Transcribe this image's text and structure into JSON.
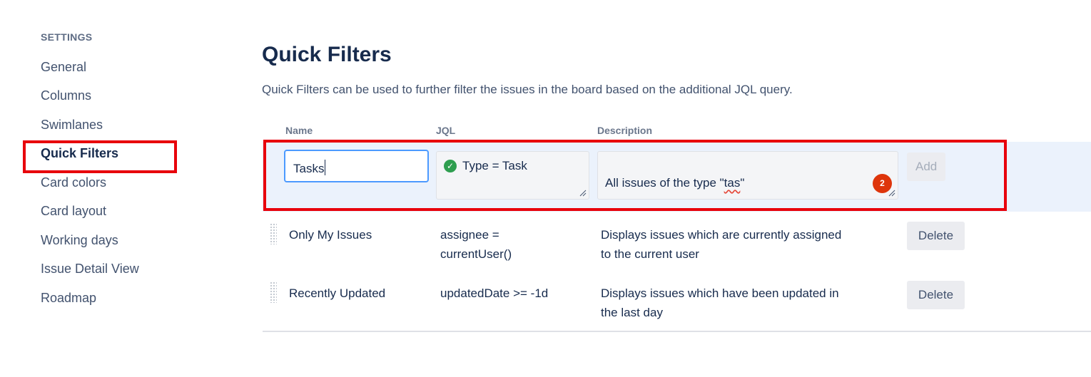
{
  "sidebar": {
    "heading": "SETTINGS",
    "items": [
      {
        "label": "General",
        "active": false
      },
      {
        "label": "Columns",
        "active": false
      },
      {
        "label": "Swimlanes",
        "active": false
      },
      {
        "label": "Quick Filters",
        "active": true
      },
      {
        "label": "Card colors",
        "active": false
      },
      {
        "label": "Card layout",
        "active": false
      },
      {
        "label": "Working days",
        "active": false
      },
      {
        "label": "Issue Detail View",
        "active": false
      },
      {
        "label": "Roadmap",
        "active": false
      }
    ]
  },
  "main": {
    "title": "Quick Filters",
    "description": "Quick Filters can be used to further filter the issues in the board based on the additional JQL query.",
    "columns": {
      "name": "Name",
      "jql": "JQL",
      "description": "Description"
    },
    "new_filter": {
      "name_value": "Tasks",
      "jql_value": "Type = Task",
      "jql_status_icon": "check-circle-icon",
      "description_prefix": "All issues of the type \"",
      "description_misspelled": "tas",
      "description_suffix": "\"",
      "badge_count": "2",
      "add_label": "Add"
    },
    "filters": [
      {
        "name": "Only My Issues",
        "jql_line1": "assignee =",
        "jql_line2": "currentUser()",
        "desc_line1": "Displays issues which are currently assigned",
        "desc_line2": "to the current user",
        "action": "Delete"
      },
      {
        "name": "Recently Updated",
        "jql_line1": "updatedDate >= -1d",
        "jql_line2": "",
        "desc_line1": "Displays issues which have been updated in",
        "desc_line2": "the last day",
        "action": "Delete"
      }
    ]
  },
  "colors": {
    "highlight": "#e8000b",
    "link": "#42526e",
    "focus": "#4c9aff"
  }
}
